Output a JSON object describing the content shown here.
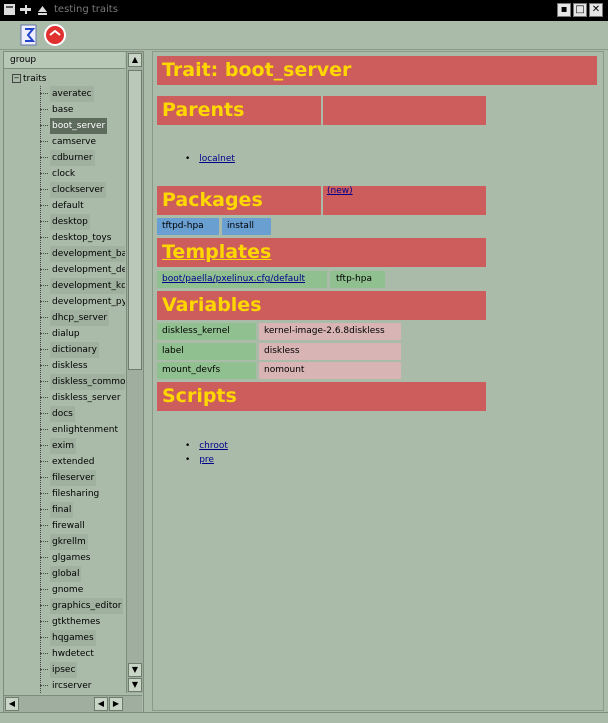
{
  "window": {
    "title": "testing traits"
  },
  "tree": {
    "header": "group",
    "root": "traits",
    "items": [
      "averatec",
      "base",
      "boot_server",
      "camserve",
      "cdburner",
      "clock",
      "clockserver",
      "default",
      "desktop",
      "desktop_toys",
      "development_ba",
      "development_de",
      "development_kd",
      "development_py",
      "dhcp_server",
      "dialup",
      "dictionary",
      "diskless",
      "diskless_commo",
      "diskless_server",
      "docs",
      "enlightenment",
      "exim",
      "extended",
      "fileserver",
      "filesharing",
      "final",
      "firewall",
      "gkrellm",
      "glgames",
      "global",
      "gnome",
      "graphics_editor",
      "gtkthemes",
      "hqgames",
      "hwdetect",
      "ipsec",
      "ircserver"
    ],
    "selected": "boot_server"
  },
  "content": {
    "title": "Trait: boot_server",
    "parents": {
      "heading": "Parents",
      "items": [
        "localnet"
      ]
    },
    "packages": {
      "heading": "Packages",
      "new_link": "(new)",
      "rows": [
        {
          "name": "tftpd-hpa",
          "action": "install"
        }
      ]
    },
    "templates": {
      "heading": "Templates",
      "rows": [
        {
          "path": "boot/paella/pxelinux.cfg/default",
          "package": "tftp-hpa"
        }
      ]
    },
    "variables": {
      "heading": "Variables",
      "rows": [
        {
          "name": "diskless_kernel",
          "value": "kernel-image-2.6.8diskless"
        },
        {
          "name": "label",
          "value": "diskless"
        },
        {
          "name": "mount_devfs",
          "value": "nomount"
        }
      ]
    },
    "scripts": {
      "heading": "Scripts",
      "items": [
        "chroot",
        "pre"
      ]
    }
  },
  "colors": {
    "header_bg": "#cd5c5c",
    "header_text": "#ffd700",
    "window_bg": "#aabba9",
    "package_cell": "#6a9fd1",
    "template_cell": "#90c090",
    "variable_value_cell": "#d8b4b4"
  },
  "icons": {
    "window_menu": "window-menu-icon",
    "pin": "pin-icon",
    "shade": "shade-icon",
    "toolbar_refresh": "refresh-icon",
    "toolbar_stop": "stop-icon"
  }
}
